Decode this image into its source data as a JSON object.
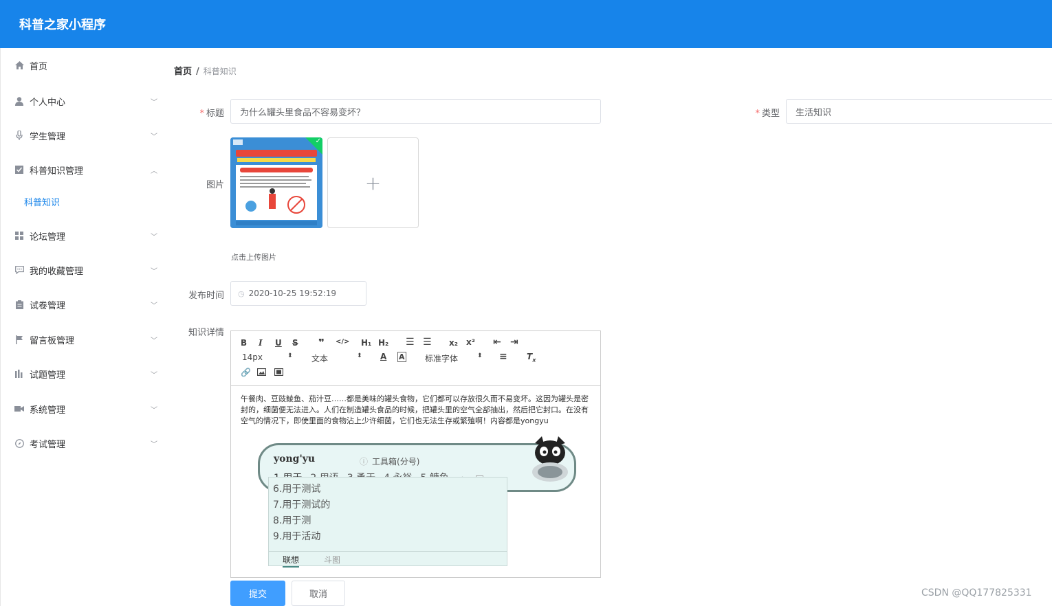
{
  "app": {
    "title": "科普之家小程序"
  },
  "sidebar": {
    "items": [
      {
        "label": "首页",
        "icon": "home-icon"
      },
      {
        "label": "个人中心",
        "icon": "user-icon"
      },
      {
        "label": "学生管理",
        "icon": "mic-icon"
      },
      {
        "label": "科普知识管理",
        "icon": "checkbox-icon"
      },
      {
        "label": "科普知识",
        "icon": ""
      },
      {
        "label": "论坛管理",
        "icon": "grid-icon"
      },
      {
        "label": "我的收藏管理",
        "icon": "chat-icon"
      },
      {
        "label": "试卷管理",
        "icon": "clipboard-icon"
      },
      {
        "label": "留言板管理",
        "icon": "flag-icon"
      },
      {
        "label": "试题管理",
        "icon": "chart-icon"
      },
      {
        "label": "系统管理",
        "icon": "camera-icon"
      },
      {
        "label": "考试管理",
        "icon": "compass-icon"
      }
    ]
  },
  "breadcrumb": {
    "home": "首页",
    "separator": "/",
    "current": "科普知识"
  },
  "form": {
    "title_label": "标题",
    "title_value": "为什么罐头里食品不容易变坏？",
    "type_label": "类型",
    "type_value": "生活知识",
    "image_label": "图片",
    "upload_plus": "+",
    "upload_tip": "点击上传图片",
    "publish_label": "发布时间",
    "publish_value": "2020-10-25 19:52:19",
    "detail_label": "知识详情",
    "required_mark": "*"
  },
  "editor": {
    "font_size": "14px",
    "paragraph": "文本",
    "font_family": "标准字体",
    "content": "午餐肉、豆豉鲮鱼、茄汁豆……都是美味的罐头食物，它们都可以存放很久而不易变坏。这因为罐头是密封的，细菌便无法进入。人们在制造罐头食品的时候，把罐头里的空气全部抽出，然后把它封口。在没有空气的情况下，即使里面的食物沾上少许细菌，它们也无法生存或繁殖啊！内容都是yongyu"
  },
  "ime": {
    "code": "yong'yu",
    "toolbox": "工具箱(分号)",
    "candidates": [
      "1.用于",
      "2.用语",
      "3.勇于",
      "4.永裕",
      "5.鳙鱼"
    ],
    "list": [
      "6.用于测试",
      "7.用于测试的",
      "8.用于测",
      "9.用于活动"
    ],
    "tabs": [
      "联想",
      "斗图"
    ]
  },
  "buttons": {
    "submit": "提交",
    "cancel": "取消"
  },
  "watermark": "CSDN @QQ177825331",
  "colors": {
    "primary": "#1784ea",
    "button": "#409eff",
    "required": "#f56c6c"
  }
}
